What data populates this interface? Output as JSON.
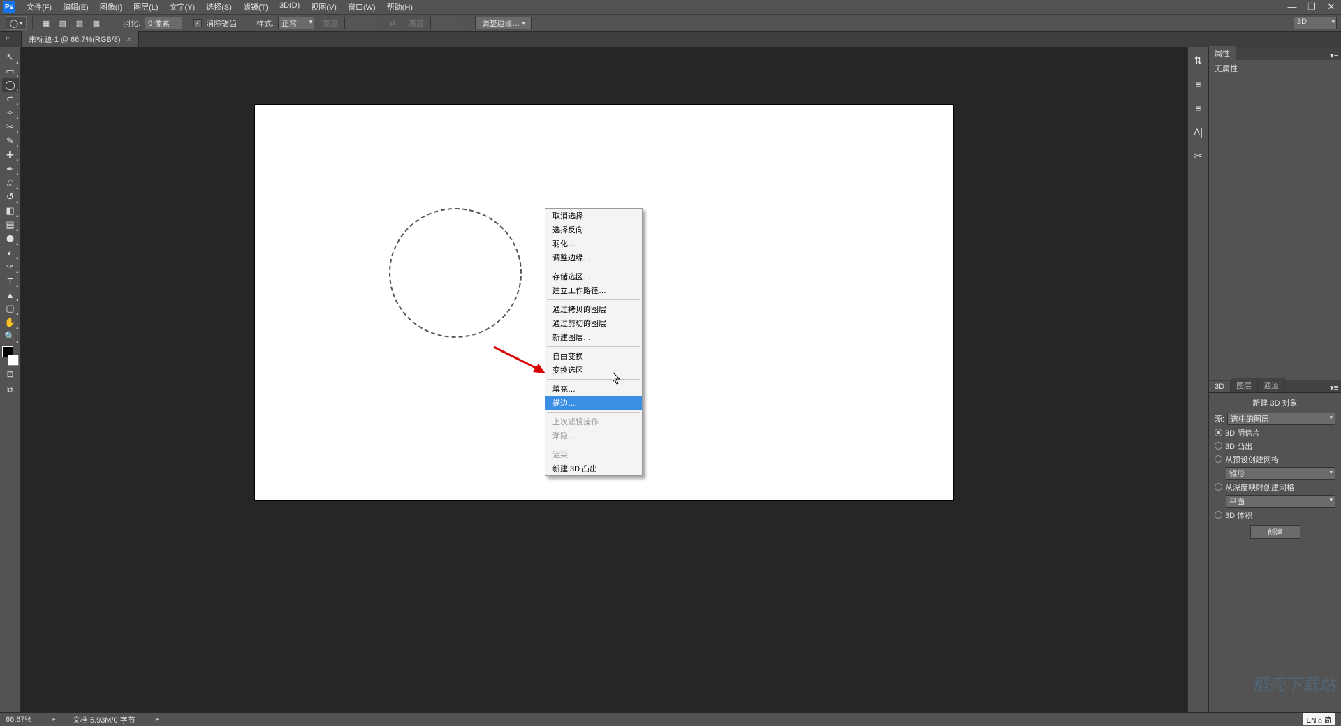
{
  "app": {
    "logo": "Ps"
  },
  "menubar": [
    "文件(F)",
    "编辑(E)",
    "图像(I)",
    "图层(L)",
    "文字(Y)",
    "选择(S)",
    "滤镜(T)",
    "3D(D)",
    "视图(V)",
    "窗口(W)",
    "帮助(H)"
  ],
  "window_controls": [
    "—",
    "❐",
    "✕"
  ],
  "optionsbar": {
    "feather_label": "羽化:",
    "feather_value": "0 像素",
    "antialias_label": "消除锯齿",
    "style_label": "样式:",
    "style_value": "正常",
    "width_label": "宽度:",
    "height_label": "高度:",
    "refine_edge": "调整边缘…",
    "workspace_mode": "3D"
  },
  "tab": {
    "title": "未标题-1 @ 66.7%(RGB/8)"
  },
  "tools": [
    {
      "name": "move-tool",
      "glyph": "↖"
    },
    {
      "name": "rect-marquee-tool",
      "glyph": "▭"
    },
    {
      "name": "ellipse-marquee-tool",
      "glyph": "◯",
      "selected": true
    },
    {
      "name": "lasso-tool",
      "glyph": "⊂"
    },
    {
      "name": "magic-wand-tool",
      "glyph": "✧"
    },
    {
      "name": "crop-tool",
      "glyph": "✂"
    },
    {
      "name": "eyedropper-tool",
      "glyph": "✎"
    },
    {
      "name": "healing-brush-tool",
      "glyph": "✚"
    },
    {
      "name": "brush-tool",
      "glyph": "✒"
    },
    {
      "name": "clone-stamp-tool",
      "glyph": "⎌"
    },
    {
      "name": "history-brush-tool",
      "glyph": "↺"
    },
    {
      "name": "eraser-tool",
      "glyph": "◧"
    },
    {
      "name": "gradient-tool",
      "glyph": "▤"
    },
    {
      "name": "blur-tool",
      "glyph": "⬢"
    },
    {
      "name": "dodge-tool",
      "glyph": "◐"
    },
    {
      "name": "pen-tool",
      "glyph": "✑"
    },
    {
      "name": "type-tool",
      "glyph": "T"
    },
    {
      "name": "path-select-tool",
      "glyph": "▲"
    },
    {
      "name": "shape-tool",
      "glyph": "▢"
    },
    {
      "name": "hand-tool",
      "glyph": "✋"
    },
    {
      "name": "zoom-tool",
      "glyph": "🔍"
    }
  ],
  "tool_extras": [
    "⊡",
    "⧉"
  ],
  "context_menu": {
    "groups": [
      [
        "取消选择",
        "选择反向",
        "羽化…",
        "调整边缘…"
      ],
      [
        "存储选区…",
        "建立工作路径…"
      ],
      [
        "通过拷贝的图层",
        "通过剪切的图层",
        "新建图层…"
      ],
      [
        "自由变换",
        "变换选区"
      ],
      [
        "填充…",
        "描边…"
      ],
      [
        {
          "label": "上次滤镜操作",
          "disabled": true
        },
        {
          "label": "渐隐…",
          "disabled": true
        }
      ],
      [
        {
          "label": "渲染",
          "disabled": true
        },
        "新建 3D 凸出"
      ]
    ],
    "hover_index": [
      4,
      1
    ]
  },
  "mini_dock_icons": [
    "⇅",
    "≡",
    "≡",
    "A|",
    "✂"
  ],
  "panels": {
    "properties": {
      "tab": "属性",
      "body": "无属性"
    },
    "lower_tabs": [
      "3D",
      "图层",
      "通道"
    ],
    "threeD": {
      "header": "新建 3D 对象",
      "source_label": "源:",
      "source_value": "选中的图层",
      "options": [
        {
          "label": "3D 明信片",
          "checked": true
        },
        {
          "label": "3D 凸出",
          "checked": false
        },
        {
          "label": "从预设创建网格",
          "checked": false,
          "select": "锥形"
        },
        {
          "label": "从深度映射创建网格",
          "checked": false,
          "select": "平面"
        },
        {
          "label": "3D 体积",
          "checked": false
        }
      ],
      "create_btn": "创建"
    }
  },
  "statusbar": {
    "zoom": "66.67%",
    "doc_info": "文档:5.93M/0 字节",
    "ime": "EN ⌂ 简"
  },
  "watermark": "稻壳下载站"
}
